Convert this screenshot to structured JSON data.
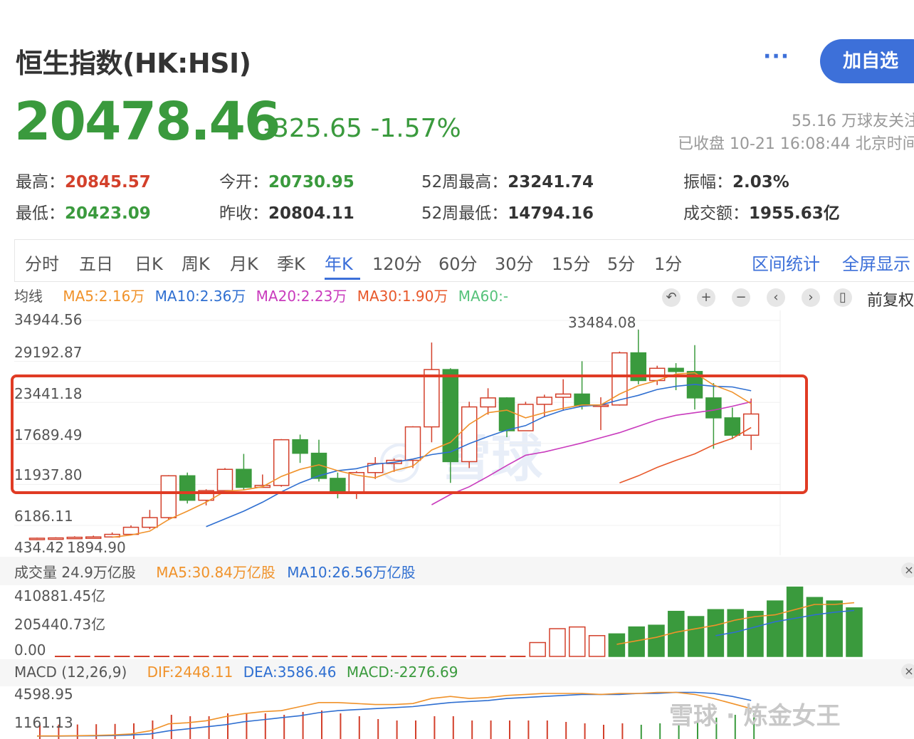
{
  "header": {
    "title": "恒生指数(HK:HSI)",
    "more_label": "···",
    "add_button": "加自选",
    "price": "20478.46",
    "change": "-325.65 -1.57%",
    "followers": "55.16 万球友关注",
    "status": "已收盘 10-21 16:08:44 北京时间"
  },
  "stats": [
    {
      "label": "最高：",
      "value": "20845.57"
    },
    {
      "label": "最低：",
      "value": "20423.09"
    },
    {
      "label": "今开：",
      "value": "20730.95"
    },
    {
      "label": "昨收：",
      "value": "20804.11"
    },
    {
      "label": "52周最高：",
      "value": "23241.74"
    },
    {
      "label": "52周最低：",
      "value": "14794.16"
    },
    {
      "label": "振幅：",
      "value": "2.03%"
    },
    {
      "label": "成交额：",
      "value": "1955.63亿"
    }
  ],
  "colors": {
    "up": "#d3402b",
    "down": "#3a9a3d",
    "accent": "#3d70d9",
    "ma5": "#f0922a",
    "ma10": "#2f6fd1",
    "ma20": "#c93bbd",
    "ma30": "#e8582a",
    "ma60": "#55c27a"
  },
  "tabs": [
    "分时",
    "五日",
    "日K",
    "周K",
    "月K",
    "季K",
    "年K",
    "120分",
    "60分",
    "30分",
    "15分",
    "5分",
    "1分"
  ],
  "active_tab": "年K",
  "tab_links": [
    "区间统计",
    "全屏显示"
  ],
  "ma_legend": {
    "title": "均线",
    "ma5": "MA5:2.16万",
    "ma10": "MA10:2.36万",
    "ma20": "MA20:2.23万",
    "ma30": "MA30:1.90万",
    "ma60": "MA60:-"
  },
  "controls": {
    "icons": [
      "undo-icon",
      "zoom-in-icon",
      "zoom-out-icon",
      "left-icon",
      "right-icon",
      "candle-icon"
    ],
    "adjust_label": "前复权"
  },
  "volume_legend": {
    "title": "成交量 24.9万亿股",
    "ma5": "MA5:30.84万亿股",
    "ma10": "MA10:26.56万亿股"
  },
  "macd_legend": {
    "title": "MACD (12,26,9)",
    "dif": "DIF:2448.11",
    "dea": "DEA:3586.46",
    "macd": "MACD:-2276.69"
  },
  "watermark": "雪球 · 炼金女王",
  "chart_data": [
    {
      "type": "candlestick",
      "y_axis_labels": [
        "34944.56",
        "29192.87",
        "23441.18",
        "17689.49",
        "11937.80",
        "6186.11",
        "434.42"
      ],
      "max_annotation": "33484.08",
      "min_annotation": "1894.90",
      "ylim": [
        434.42,
        34944.56
      ],
      "candles": [
        {
          "o": 1000,
          "c": 1100,
          "h": 1200,
          "l": 800
        },
        {
          "o": 1050,
          "c": 1150,
          "h": 1250,
          "l": 900
        },
        {
          "o": 1150,
          "c": 1250,
          "h": 1400,
          "l": 1000
        },
        {
          "o": 1200,
          "c": 1300,
          "h": 1500,
          "l": 1100
        },
        {
          "o": 1300,
          "c": 1700,
          "h": 2000,
          "l": 1200
        },
        {
          "o": 1700,
          "c": 2800,
          "h": 3100,
          "l": 1600
        },
        {
          "o": 2800,
          "c": 4300,
          "h": 5500,
          "l": 2500
        },
        {
          "o": 4300,
          "c": 10800,
          "h": 10900,
          "l": 3900
        },
        {
          "o": 10800,
          "c": 7000,
          "h": 11300,
          "l": 6500
        },
        {
          "o": 7000,
          "c": 8500,
          "h": 8700,
          "l": 6200
        },
        {
          "o": 8500,
          "c": 11800,
          "h": 12000,
          "l": 8300
        },
        {
          "o": 11800,
          "c": 9000,
          "h": 14200,
          "l": 8600
        },
        {
          "o": 9000,
          "c": 9300,
          "h": 11000,
          "l": 9000
        },
        {
          "o": 9300,
          "c": 16400,
          "h": 16500,
          "l": 9100
        },
        {
          "o": 16400,
          "c": 14300,
          "h": 17200,
          "l": 12800
        },
        {
          "o": 14300,
          "c": 10400,
          "h": 16400,
          "l": 9900
        },
        {
          "o": 10400,
          "c": 8300,
          "h": 11300,
          "l": 7300
        },
        {
          "o": 8300,
          "c": 11300,
          "h": 11500,
          "l": 7200
        },
        {
          "o": 11300,
          "c": 12700,
          "h": 13700,
          "l": 10300
        },
        {
          "o": 12700,
          "c": 13200,
          "h": 13500,
          "l": 11400
        },
        {
          "o": 13200,
          "c": 18400,
          "h": 18500,
          "l": 12000
        },
        {
          "o": 18400,
          "c": 27300,
          "h": 31500,
          "l": 16000
        },
        {
          "o": 27300,
          "c": 13000,
          "h": 27500,
          "l": 9700
        },
        {
          "o": 13000,
          "c": 21500,
          "h": 22300,
          "l": 12000
        },
        {
          "o": 21500,
          "c": 22900,
          "h": 24400,
          "l": 20300
        },
        {
          "o": 22900,
          "c": 17800,
          "h": 23000,
          "l": 16800
        },
        {
          "o": 17800,
          "c": 21900,
          "h": 22300,
          "l": 17800
        },
        {
          "o": 21900,
          "c": 23000,
          "h": 23400,
          "l": 19900
        },
        {
          "o": 23000,
          "c": 23500,
          "h": 25800,
          "l": 20900
        },
        {
          "o": 23500,
          "c": 21700,
          "h": 28600,
          "l": 21100
        },
        {
          "o": 21700,
          "c": 21800,
          "h": 23000,
          "l": 17900
        },
        {
          "o": 21800,
          "c": 29900,
          "h": 30100,
          "l": 21700
        },
        {
          "o": 29900,
          "c": 25600,
          "h": 33484.08,
          "l": 25000
        },
        {
          "o": 25600,
          "c": 27500,
          "h": 27900,
          "l": 24900
        },
        {
          "o": 27500,
          "c": 27000,
          "h": 28300,
          "l": 24100
        },
        {
          "o": 27000,
          "c": 22900,
          "h": 31100,
          "l": 21100
        },
        {
          "o": 22900,
          "c": 19800,
          "h": 25200,
          "l": 15000
        },
        {
          "o": 19800,
          "c": 17100,
          "h": 21400,
          "l": 16500
        },
        {
          "o": 17100,
          "c": 20400,
          "h": 22800,
          "l": 14800
        }
      ],
      "ma5": [
        null,
        null,
        null,
        null,
        1250,
        1600,
        2200,
        4000,
        5300,
        6700,
        8400,
        8600,
        9100,
        10700,
        11800,
        12500,
        11600,
        10900,
        10500,
        11600,
        12300,
        14800,
        16000,
        18800,
        20600,
        21000,
        19800,
        20600,
        21300,
        21800,
        21800,
        23500,
        24800,
        25600,
        26600,
        26800,
        24900,
        23800,
        22000
      ],
      "ma10": [
        null,
        null,
        null,
        null,
        null,
        null,
        null,
        null,
        null,
        2900,
        null,
        5300,
        6700,
        8300,
        9700,
        10800,
        11600,
        11900,
        12600,
        12900,
        13400,
        14100,
        14500,
        15800,
        16900,
        17900,
        18600,
        20000,
        21000,
        21600,
        21800,
        22600,
        23300,
        24200,
        24700,
        25000,
        24700,
        24600,
        24000
      ],
      "ma20": [
        null,
        null,
        null,
        null,
        null,
        null,
        null,
        null,
        null,
        null,
        null,
        null,
        null,
        null,
        null,
        null,
        null,
        null,
        null,
        null,
        null,
        6300,
        7900,
        9100,
        10700,
        12400,
        14000,
        14500,
        15200,
        15900,
        16700,
        17500,
        18500,
        19500,
        20200,
        20600,
        21000,
        21600,
        22300
      ],
      "ma30": [
        null,
        null,
        null,
        null,
        null,
        null,
        null,
        null,
        null,
        null,
        null,
        null,
        null,
        null,
        null,
        null,
        null,
        null,
        null,
        null,
        null,
        null,
        null,
        null,
        null,
        null,
        null,
        null,
        null,
        null,
        null,
        9700,
        10800,
        12100,
        13200,
        14200,
        15600,
        16600,
        18300
      ]
    },
    {
      "type": "bar",
      "title": "成交量",
      "y_axis_labels": [
        "410881.45亿",
        "205440.73亿",
        "0.00"
      ],
      "ylim": [
        0,
        410881.45
      ],
      "values": [
        0,
        0,
        0,
        0,
        0,
        0,
        0,
        0,
        0,
        0,
        0,
        0,
        0,
        0,
        0,
        0,
        0,
        0,
        0,
        0,
        0,
        0,
        0,
        0,
        80000,
        160000,
        170000,
        120000,
        130000,
        170000,
        180000,
        260000,
        230000,
        270000,
        270000,
        260000,
        320000,
        400000,
        340000,
        320000,
        280000
      ],
      "ma5": [
        null,
        null,
        null,
        null,
        null,
        null,
        null,
        null,
        null,
        null,
        null,
        null,
        null,
        null,
        null,
        null,
        null,
        null,
        null,
        null,
        null,
        null,
        null,
        null,
        null,
        null,
        null,
        null,
        70000,
        90000,
        110000,
        140000,
        160000,
        180000,
        210000,
        230000,
        240000,
        270000,
        300000,
        300000,
        310000
      ],
      "ma10": [
        null,
        null,
        null,
        null,
        null,
        null,
        null,
        null,
        null,
        null,
        null,
        null,
        null,
        null,
        null,
        null,
        null,
        null,
        null,
        null,
        null,
        null,
        null,
        null,
        null,
        null,
        null,
        null,
        null,
        null,
        null,
        null,
        null,
        120000,
        140000,
        170000,
        200000,
        220000,
        240000,
        255000,
        265000
      ]
    },
    {
      "type": "line",
      "title": "MACD",
      "y_axis_labels": [
        "4598.95",
        "1161.13"
      ],
      "ylim": [
        0,
        5200
      ],
      "dif": [
        300,
        300,
        320,
        350,
        400,
        500,
        800,
        1500,
        1600,
        1800,
        2200,
        2500,
        2700,
        2800,
        3200,
        3600,
        3600,
        3500,
        3400,
        3400,
        3500,
        4000,
        4200,
        4000,
        4100,
        4300,
        4400,
        4500,
        4500,
        4500,
        4400,
        4500,
        4500,
        4600,
        4600,
        4400,
        4000,
        3500,
        3000
      ],
      "dea": [
        280,
        290,
        300,
        310,
        340,
        400,
        500,
        800,
        1000,
        1200,
        1400,
        1700,
        1900,
        2100,
        2300,
        2600,
        2800,
        2900,
        3000,
        3100,
        3200,
        3400,
        3600,
        3700,
        3800,
        4000,
        4100,
        4200,
        4300,
        4400,
        4400,
        4400,
        4500,
        4500,
        4600,
        4600,
        4500,
        4200,
        3800
      ]
    }
  ]
}
